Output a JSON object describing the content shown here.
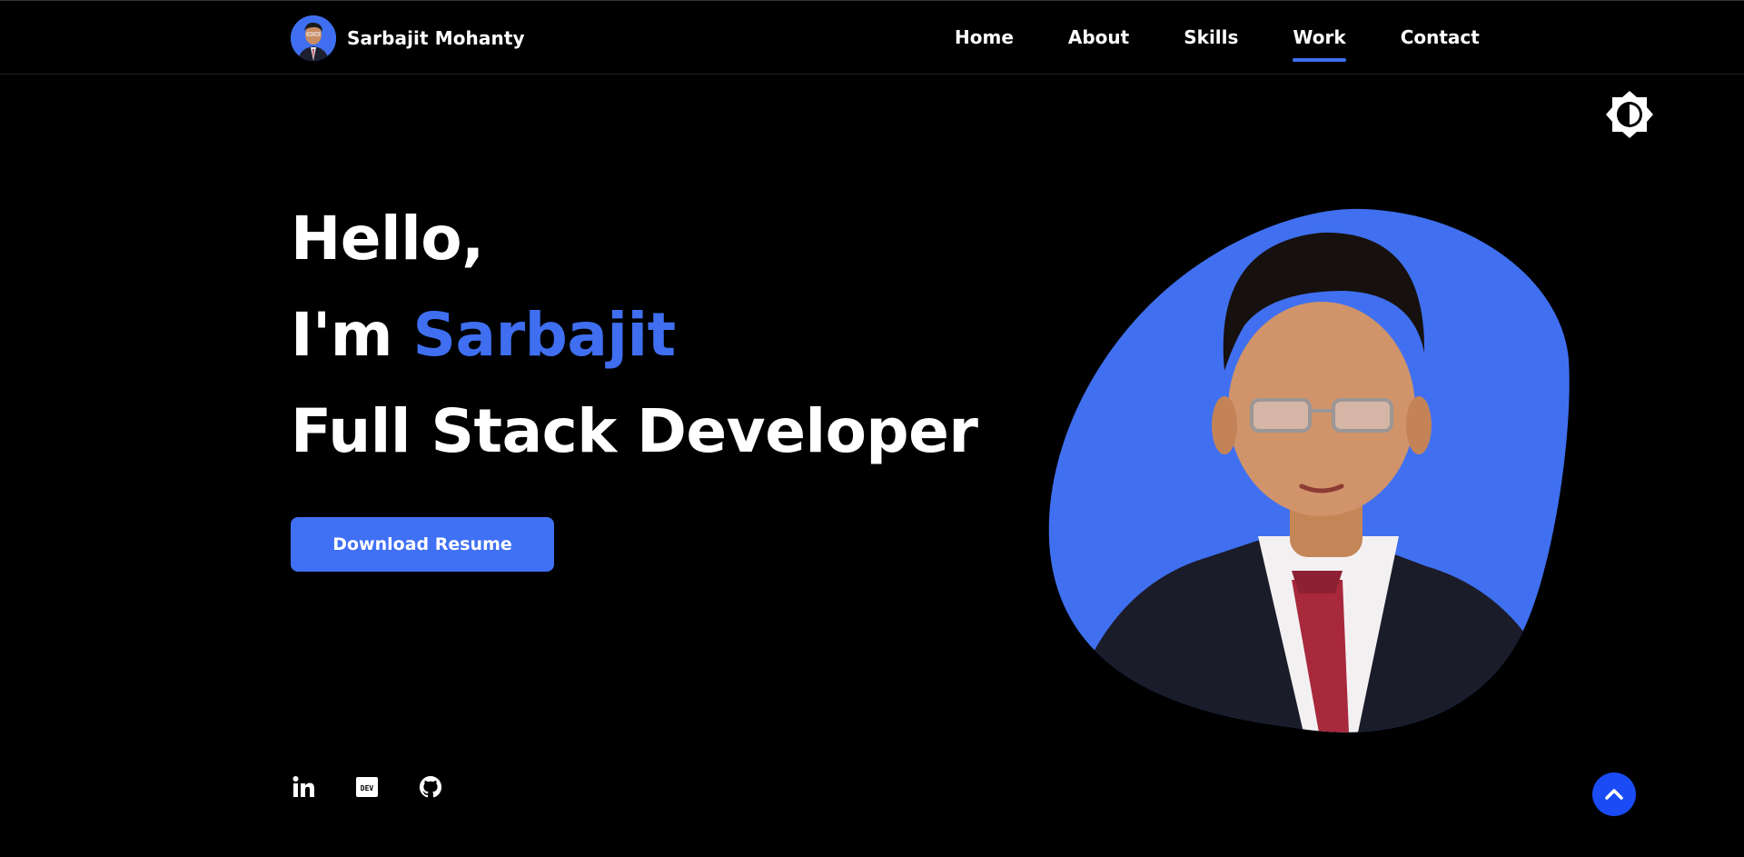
{
  "header": {
    "brand_name": "Sarbajit Mohanty",
    "nav": [
      {
        "label": "Home"
      },
      {
        "label": "About"
      },
      {
        "label": "Skills"
      },
      {
        "label": "Work",
        "active": true
      },
      {
        "label": "Contact"
      }
    ]
  },
  "hero": {
    "greeting": "Hello,",
    "intro_prefix": "I'm ",
    "name": "Sarbajit",
    "role": "Full Stack Developer",
    "cta_label": "Download Resume"
  },
  "social_icons": [
    "linkedin-icon",
    "dev-icon",
    "github-icon"
  ],
  "dev_icon_text": "DEV",
  "colors": {
    "accent": "#3f6ff0",
    "button": "#4070f4",
    "scroll_top": "#1a4bf5",
    "background": "#000000"
  }
}
